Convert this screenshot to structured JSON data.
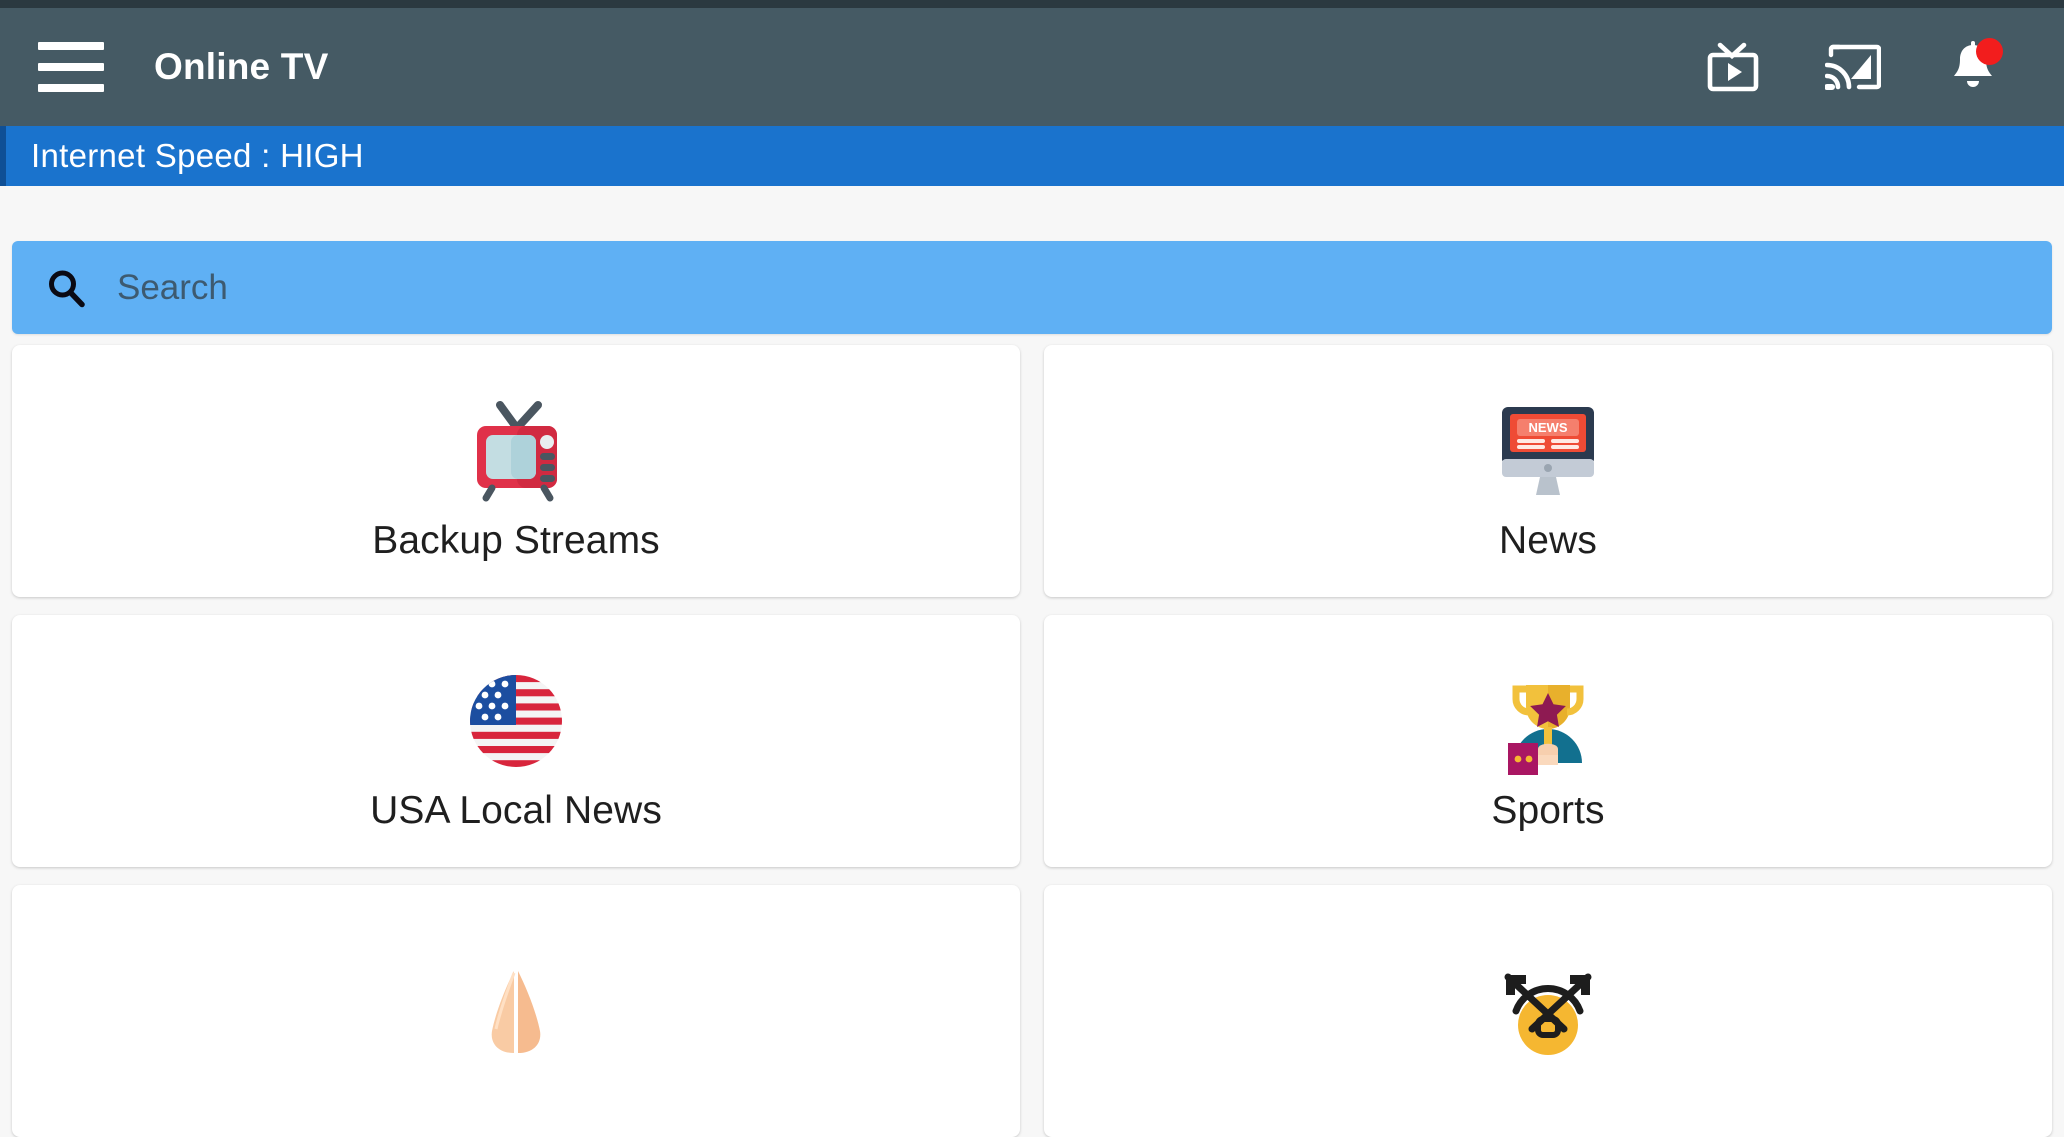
{
  "toolbar": {
    "menu_icon": "hamburger-menu-icon",
    "title": "Online TV",
    "actions": [
      {
        "name": "live-tv-icon",
        "label": "Live TV"
      },
      {
        "name": "cast-icon",
        "label": "Cast"
      },
      {
        "name": "notifications-icon",
        "label": "Notifications",
        "badge": true
      }
    ],
    "background_color": "#455a64"
  },
  "speed_bar": {
    "text": "Internet Speed : HIGH",
    "background_color": "#1a73cd",
    "accent_color": "#0f4f95"
  },
  "search": {
    "placeholder": "Search",
    "value": "",
    "icon": "search-icon",
    "background_color": "#5fb0f4"
  },
  "grid": {
    "cards": [
      {
        "label": "Backup Streams",
        "icon": "retro-tv-icon"
      },
      {
        "label": "News",
        "icon": "news-monitor-icon"
      },
      {
        "label": "USA Local News",
        "icon": "usa-flag-icon"
      },
      {
        "label": "Sports",
        "icon": "trophy-icon"
      },
      {
        "label": "",
        "icon": "praying-hands-icon"
      },
      {
        "label": "",
        "icon": "crossed-arrows-icon"
      }
    ]
  },
  "page": {
    "background_color": "#f7f7f7",
    "card_background": "#ffffff",
    "label_color": "#1f1f1f"
  }
}
